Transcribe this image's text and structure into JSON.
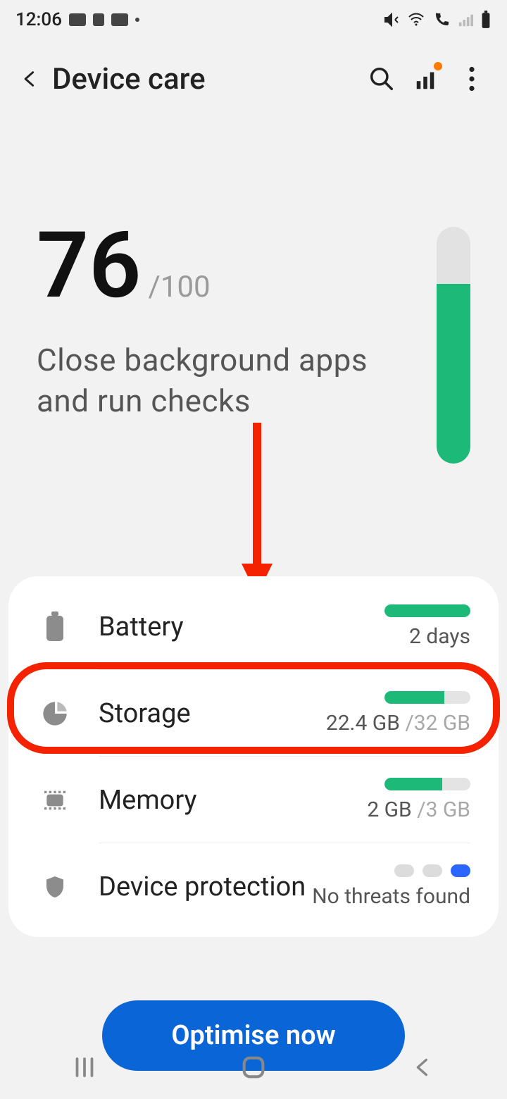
{
  "status": {
    "time": "12:06"
  },
  "header": {
    "title": "Device care"
  },
  "score": {
    "value": "76",
    "max": "/100",
    "message": "Close background apps and run checks",
    "percent": 76
  },
  "items": {
    "battery": {
      "label": "Battery",
      "sub": "2 days",
      "fill": 100
    },
    "storage": {
      "label": "Storage",
      "used": "22.4 GB ",
      "total": "/32 GB",
      "fill": 70
    },
    "memory": {
      "label": "Memory",
      "used": "2 GB ",
      "total": "/3 GB",
      "fill": 67
    },
    "protection": {
      "label": "Device protection",
      "sub": "No threats found"
    }
  },
  "button": {
    "optimise": "Optimise now"
  }
}
